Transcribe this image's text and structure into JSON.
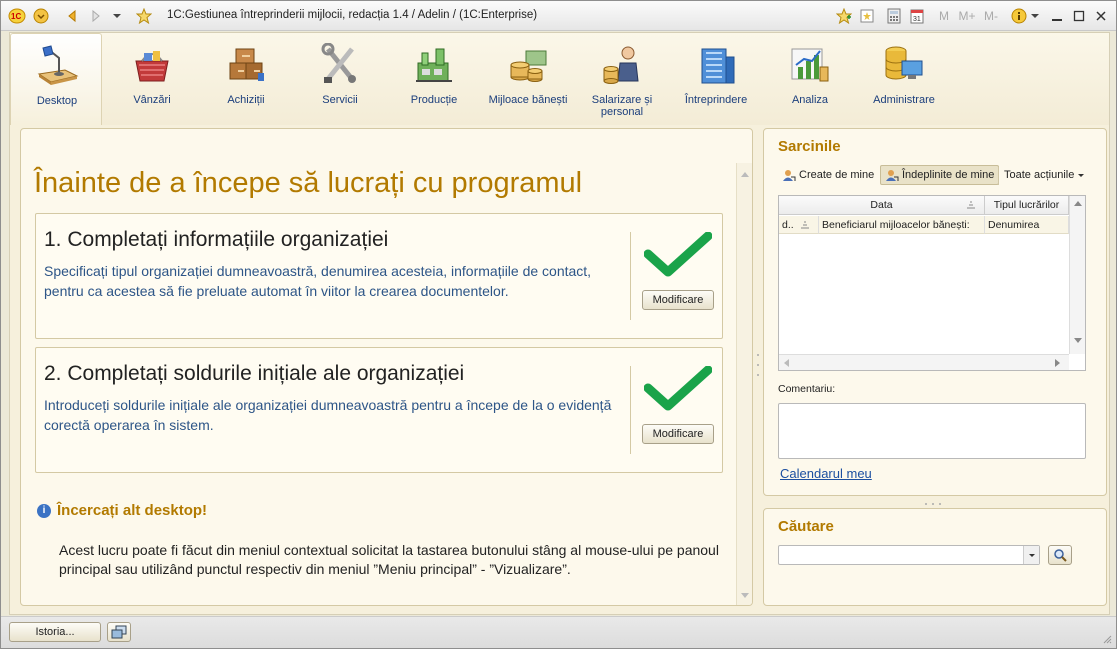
{
  "titlebar": {
    "title": "1C:Gestiunea întreprinderii mijlocii, redacția 1.4 / Adelin / (1C:Enterprise)",
    "memory_buttons": [
      "M",
      "M+",
      "M-"
    ],
    "window_controls": [
      "minimize-icon",
      "maximize-icon",
      "close-icon"
    ]
  },
  "sections": [
    {
      "label": "Desktop",
      "icon": "desktop-lamp-icon",
      "active": true
    },
    {
      "label": "Vânzări",
      "icon": "shopping-basket-icon"
    },
    {
      "label": "Achiziții",
      "icon": "boxes-icon"
    },
    {
      "label": "Servicii",
      "icon": "tools-icon"
    },
    {
      "label": "Producție",
      "icon": "factory-icon"
    },
    {
      "label": "Mijloace bănești",
      "icon": "coins-icon"
    },
    {
      "label": "Salarizare și personal",
      "icon": "worker-coins-icon"
    },
    {
      "label": "Întreprindere",
      "icon": "building-icon"
    },
    {
      "label": "Analiza",
      "icon": "chart-icon"
    },
    {
      "label": "Administrare",
      "icon": "database-icon"
    }
  ],
  "start": {
    "heading": "Înainte de a începe să lucrați cu programul",
    "steps": [
      {
        "title": "1. Completați informațiile organizației",
        "text": "Specificați tipul organizației dumneavoastră, denumirea acesteia, informațiile de contact, pentru ca acestea să fie preluate automat în viitor la crearea documentelor.",
        "button": "Modificare",
        "done": true
      },
      {
        "title": "2. Completați soldurile inițiale ale organizației",
        "text": "Introduceți soldurile inițiale ale organizației dumneavoastră pentru a începe de la o evidență corectă operarea în sistem.",
        "button": "Modificare",
        "done": true
      }
    ],
    "alt_title": "Încercați alt desktop!",
    "alt_text": "Acest lucru poate fi făcut din meniul contextual solicitat la tastarea butonului stâng al mouse-ului pe panoul principal sau utilizând punctul respectiv din meniul ”Meniu principal” - ”Vizualizare”."
  },
  "tasks": {
    "title": "Sarcinile",
    "toolbar": {
      "created_by_me": "Create de mine",
      "done_by_me": "Îndeplinite de mine",
      "all_actions": "Toate acțiunile"
    },
    "columns": [
      "Data",
      "Tipul lucrărilor"
    ],
    "row": {
      "col1": "d..",
      "col2": "Beneficiarul mijloacelor bănești:",
      "col3": "Denumirea"
    },
    "comment_label": "Comentariu:",
    "calendar_link": "Calendarul meu"
  },
  "search": {
    "title": "Căutare",
    "placeholder": ""
  },
  "statusbar": {
    "history_button": "Istoria..."
  },
  "colors": {
    "accent": "#b27a00",
    "link": "#1c4fa0",
    "check": "#1aa34a",
    "text_blue": "#2d5587"
  }
}
